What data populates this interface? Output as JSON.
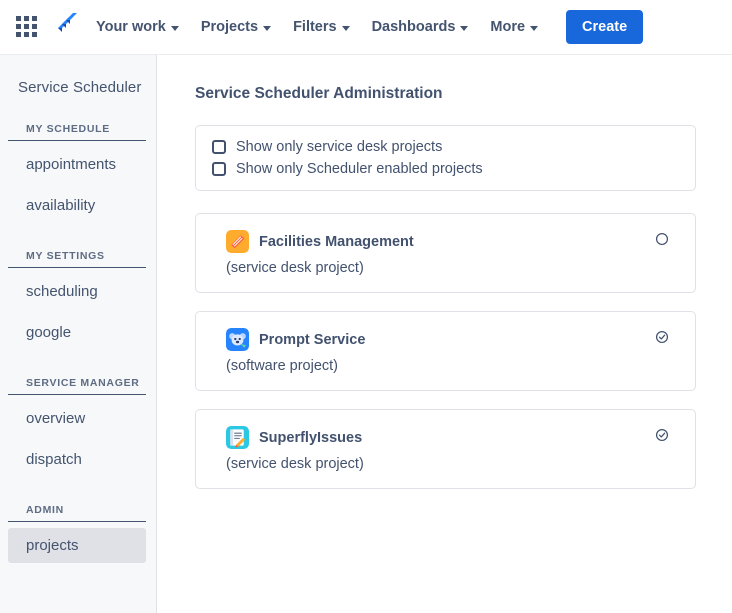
{
  "topnav": {
    "app_switcher_icon": "grid-apps-icon",
    "logo_icon": "jira-logo-icon",
    "links": [
      {
        "label": "Your work",
        "has_caret": true
      },
      {
        "label": "Projects",
        "has_caret": true
      },
      {
        "label": "Filters",
        "has_caret": true
      },
      {
        "label": "Dashboards",
        "has_caret": true
      },
      {
        "label": "More",
        "has_caret": true
      }
    ],
    "create_label": "Create",
    "create_color": "#1868DB"
  },
  "sidebar": {
    "title": "Service Scheduler",
    "sections": [
      {
        "header": "MY SCHEDULE",
        "items": [
          {
            "label": "appointments",
            "selected": false
          },
          {
            "label": "availability",
            "selected": false
          }
        ]
      },
      {
        "header": "MY SETTINGS",
        "items": [
          {
            "label": "scheduling",
            "selected": false
          },
          {
            "label": "google",
            "selected": false
          }
        ]
      },
      {
        "header": "SERVICE MANAGER",
        "items": [
          {
            "label": "overview",
            "selected": false
          },
          {
            "label": "dispatch",
            "selected": false
          }
        ]
      },
      {
        "header": "ADMIN",
        "items": [
          {
            "label": "projects",
            "selected": true
          }
        ]
      }
    ]
  },
  "main": {
    "page_title": "Service Scheduler Administration",
    "filters": [
      {
        "label": "Show only service desk projects",
        "checked": false
      },
      {
        "label": "Show only Scheduler enabled projects",
        "checked": false
      }
    ],
    "projects": [
      {
        "name": "Facilities Management",
        "type": "(service desk project)",
        "icon": "pen-orange-project-icon",
        "icon_bg": "#FFAB2E",
        "enabled": false,
        "toggle_icon": "circle-empty-icon"
      },
      {
        "name": "Prompt Service",
        "type": "(software project)",
        "icon": "koala-blue-project-icon",
        "icon_bg": "#2684FF",
        "enabled": true,
        "toggle_icon": "circle-check-icon"
      },
      {
        "name": "SuperflyIssues",
        "type": "(service desk project)",
        "icon": "notepad-cyan-project-icon",
        "icon_bg": "#2BC8E4",
        "enabled": true,
        "toggle_icon": "circle-check-icon"
      }
    ]
  }
}
